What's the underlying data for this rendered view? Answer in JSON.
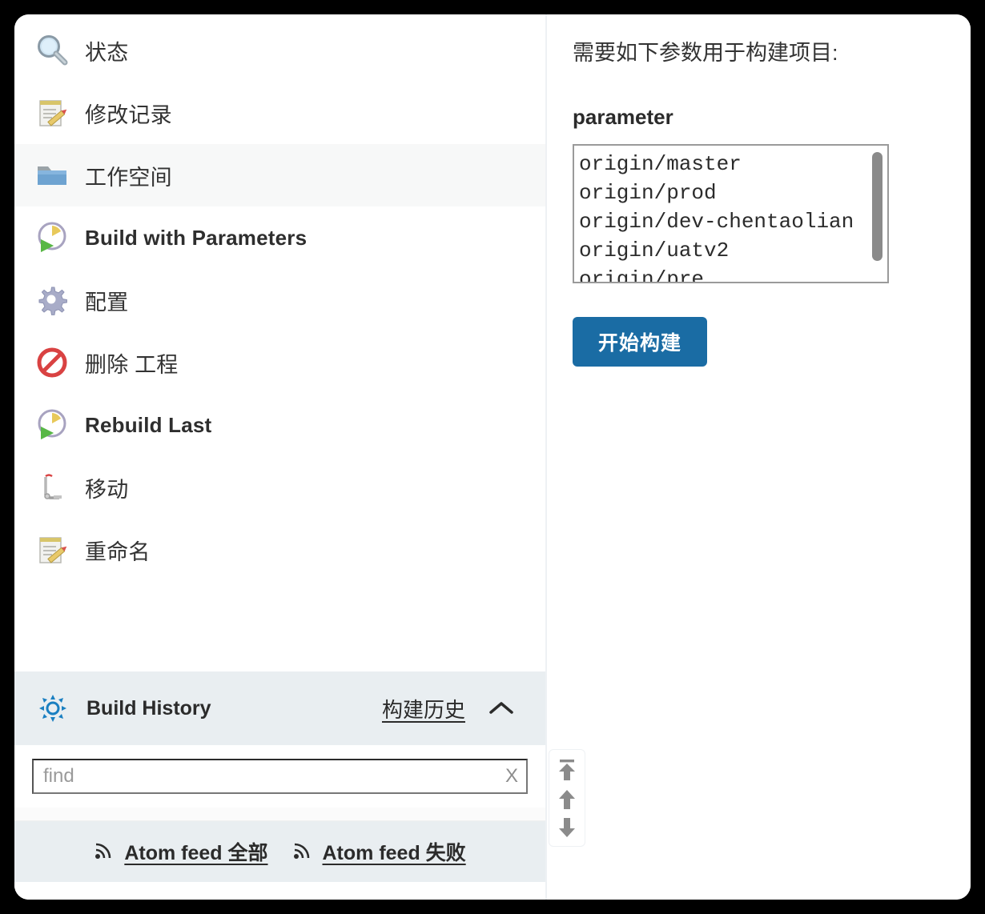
{
  "sidebar": {
    "items": [
      {
        "label": "状态",
        "icon": "magnifier-icon",
        "selected": false
      },
      {
        "label": "修改记录",
        "icon": "notepad-pencil-icon",
        "selected": false
      },
      {
        "label": "工作空间",
        "icon": "folder-icon",
        "selected": true
      },
      {
        "label": "Build with Parameters",
        "icon": "clock-play-icon",
        "selected": false
      },
      {
        "label": "配置",
        "icon": "gear-icon",
        "selected": false
      },
      {
        "label": "删除 工程",
        "icon": "forbidden-icon",
        "selected": false
      },
      {
        "label": "Rebuild Last",
        "icon": "clock-play-icon",
        "selected": false
      },
      {
        "label": "移动",
        "icon": "crane-icon",
        "selected": false
      },
      {
        "label": "重命名",
        "icon": "notepad-pencil-icon",
        "selected": false
      }
    ],
    "build_history": {
      "title": "Build History",
      "link_label": "构建历史",
      "collapse_icon": "chevron-up-icon",
      "weather_icon": "weather-sun-icon"
    },
    "find": {
      "placeholder": "find",
      "value": "",
      "clear_label": "X"
    },
    "feeds": [
      {
        "label": "Atom feed 全部",
        "icon": "rss-icon"
      },
      {
        "label": "Atom feed 失败",
        "icon": "rss-icon"
      }
    ],
    "scroll_widget": {
      "buttons": [
        {
          "name": "scroll-to-top",
          "icon": "arrow-up-to-bar-icon"
        },
        {
          "name": "scroll-up",
          "icon": "arrow-up-icon"
        },
        {
          "name": "scroll-down",
          "icon": "arrow-down-icon"
        }
      ]
    }
  },
  "main": {
    "intro": "需要如下参数用于构建项目:",
    "parameter_name": "parameter",
    "options": [
      "origin/master",
      "origin/prod",
      "origin/dev-chentaolian",
      "origin/uatv2",
      "origin/pre"
    ],
    "build_button": "开始构建"
  },
  "colors": {
    "accent": "#1a6ca4",
    "band": "#e9eef1",
    "selected_row": "#f7f8f8"
  }
}
